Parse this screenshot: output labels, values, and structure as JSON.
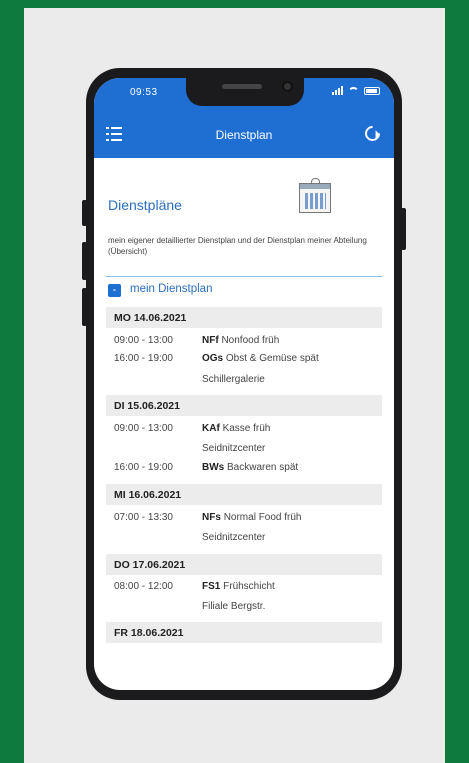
{
  "status": {
    "time": "09:53"
  },
  "nav": {
    "title": "Dienstplan"
  },
  "page": {
    "title": "Dienstpläne",
    "description": "mein eigener detaillierter Dienstplan und der Dienstplan meiner Abteilung (Übersicht)",
    "section": {
      "toggle": "-",
      "title": "mein Dienstplan"
    }
  },
  "days": [
    {
      "label": "MO 14.06.2021",
      "entries": [
        {
          "time": "09:00 - 13:00",
          "code": "NFf",
          "name": "Nonfood früh"
        },
        {
          "time": "16:00 - 19:00",
          "code": "OGs",
          "name": "Obst & Gemüse spät",
          "location": "Schillergalerie"
        }
      ]
    },
    {
      "label": "DI 15.06.2021",
      "entries": [
        {
          "time": "09:00 - 13:00",
          "code": "KAf",
          "name": "Kasse früh",
          "location": "Seidnitzcenter"
        },
        {
          "time": "16:00 - 19:00",
          "code": "BWs",
          "name": "Backwaren spät"
        }
      ]
    },
    {
      "label": "MI 16.06.2021",
      "entries": [
        {
          "time": "07:00 - 13:30",
          "code": "NFs",
          "name": "Normal Food früh",
          "location": "Seidnitzcenter"
        }
      ]
    },
    {
      "label": "DO 17.06.2021",
      "entries": [
        {
          "time": "08:00 - 12:00",
          "code": "FS1",
          "name": "Frühschicht",
          "location": "Filiale Bergstr."
        }
      ]
    },
    {
      "label": "FR 18.06.2021",
      "entries": []
    }
  ]
}
